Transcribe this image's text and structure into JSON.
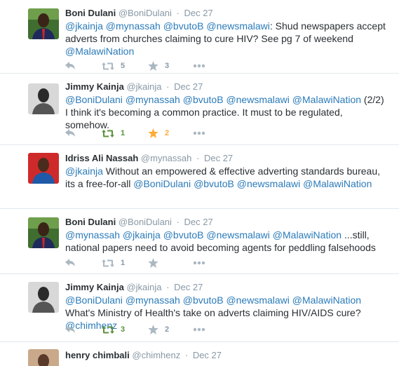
{
  "tweets": [
    {
      "name": "Boni Dulani",
      "handle": "@BoniDulani",
      "sep": "·",
      "date": "Dec 27",
      "segments": [
        {
          "t": "@jkainja",
          "m": true
        },
        {
          "t": " ",
          "m": false
        },
        {
          "t": "@mynassah",
          "m": true
        },
        {
          "t": " ",
          "m": false
        },
        {
          "t": "@bvutoB",
          "m": true
        },
        {
          "t": " ",
          "m": false
        },
        {
          "t": "@newsmalawi",
          "m": true
        },
        {
          "t": ": Shud newspapers accept adverts from churches claiming to cure HIV? See pg 7 of weekend ",
          "m": false
        },
        {
          "t": "@MalawiNation",
          "m": true
        }
      ],
      "retweets": "5",
      "retweeted": false,
      "favorites": "3",
      "favorited": false,
      "avatar": "boni"
    },
    {
      "name": "Jimmy Kainja",
      "handle": "@jkainja",
      "sep": "·",
      "date": "Dec 27",
      "segments": [
        {
          "t": "@BoniDulani",
          "m": true
        },
        {
          "t": " ",
          "m": false
        },
        {
          "t": "@mynassah",
          "m": true
        },
        {
          "t": " ",
          "m": false
        },
        {
          "t": "@bvutoB",
          "m": true
        },
        {
          "t": " ",
          "m": false
        },
        {
          "t": "@newsmalawi",
          "m": true
        },
        {
          "t": " ",
          "m": false
        },
        {
          "t": "@MalawiNation",
          "m": true
        },
        {
          "t": " (2/2) I think it's becoming a common practice. It must to be regulated, somehow.",
          "m": false
        }
      ],
      "retweets": "1",
      "retweeted": true,
      "favorites": "2",
      "favorited": true,
      "avatar": "jimmy"
    },
    {
      "name": "Idriss Ali Nassah",
      "handle": "@mynassah",
      "sep": "·",
      "date": "Dec 27",
      "segments": [
        {
          "t": "@jkainja",
          "m": true
        },
        {
          "t": " Without an empowered & effective adverting standards bureau, its a free-for-all  ",
          "m": false
        },
        {
          "t": "@BoniDulani",
          "m": true
        },
        {
          "t": " ",
          "m": false
        },
        {
          "t": "@bvutoB",
          "m": true
        },
        {
          "t": " ",
          "m": false
        },
        {
          "t": "@newsmalawi",
          "m": true
        },
        {
          "t": " ",
          "m": false
        },
        {
          "t": "@MalawiNation",
          "m": true
        }
      ],
      "retweets": "",
      "retweeted": false,
      "favorites": "",
      "favorited": false,
      "avatar": "idriss"
    },
    {
      "name": "Boni Dulani",
      "handle": "@BoniDulani",
      "sep": "·",
      "date": "Dec 27",
      "segments": [
        {
          "t": "@mynassah",
          "m": true
        },
        {
          "t": " ",
          "m": false
        },
        {
          "t": "@jkainja",
          "m": true
        },
        {
          "t": " ",
          "m": false
        },
        {
          "t": "@bvutoB",
          "m": true
        },
        {
          "t": " ",
          "m": false
        },
        {
          "t": "@newsmalawi",
          "m": true
        },
        {
          "t": " ",
          "m": false
        },
        {
          "t": "@MalawiNation",
          "m": true
        },
        {
          "t": " ...still, national papers need to avoid becoming agents for peddling falsehoods",
          "m": false
        }
      ],
      "retweets": "1",
      "retweeted": false,
      "favorites": "",
      "favorited": false,
      "avatar": "boni"
    },
    {
      "name": "Jimmy Kainja",
      "handle": "@jkainja",
      "sep": "·",
      "date": "Dec 27",
      "segments": [
        {
          "t": "@BoniDulani",
          "m": true
        },
        {
          "t": " ",
          "m": false
        },
        {
          "t": "@mynassah",
          "m": true
        },
        {
          "t": " ",
          "m": false
        },
        {
          "t": "@bvutoB",
          "m": true
        },
        {
          "t": " ",
          "m": false
        },
        {
          "t": "@newsmalawi",
          "m": true
        },
        {
          "t": " ",
          "m": false
        },
        {
          "t": "@MalawiNation",
          "m": true
        },
        {
          "t": " What's Ministry of Health's take on adverts claiming HIV/AIDS cure? ",
          "m": false
        },
        {
          "t": "@chimhenz",
          "m": true
        }
      ],
      "retweets": "3",
      "retweeted": true,
      "favorites": "2",
      "favorited": false,
      "avatar": "jimmy"
    },
    {
      "name": "henry chimbali",
      "handle": "@chimhenz",
      "sep": "·",
      "date": "Dec 27",
      "segments": [],
      "retweets": "",
      "retweeted": false,
      "favorites": "",
      "favorited": false,
      "avatar": "henry"
    }
  ],
  "colors": {
    "mention": "#2b7bb9",
    "retweet_active": "#5c913b",
    "favorite_active": "#ffac33",
    "icon_inactive": "#aab8c2"
  }
}
